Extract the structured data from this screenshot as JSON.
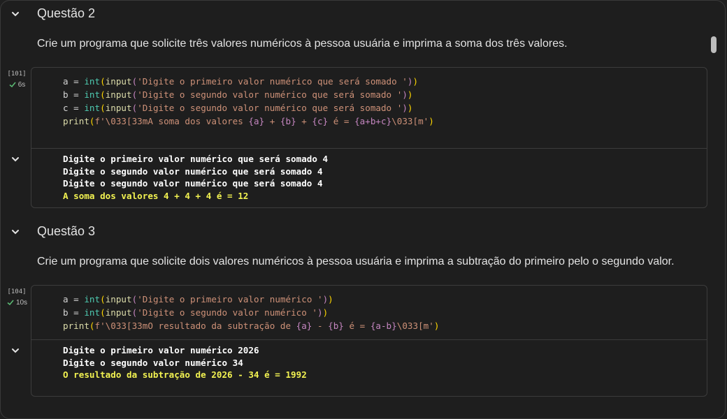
{
  "q2": {
    "title": "Questão 2",
    "desc": "Crie um programa que solicite três valores numéricos à pessoa usuária e imprima a soma dos três valores.",
    "exec_count": "[101]",
    "exec_time": "6s",
    "code": {
      "l1": {
        "pre": "a = ",
        "kw": "int",
        "p1": "(",
        "fn": "input",
        "p2": "(",
        "str": "'Digite o primeiro valor numérico que será somado '",
        "p3": ")",
        "p4": ")"
      },
      "l2": {
        "pre": "b = ",
        "kw": "int",
        "p1": "(",
        "fn": "input",
        "p2": "(",
        "str": "'Digite o segundo valor numérico que será somado '",
        "p3": ")",
        "p4": ")"
      },
      "l3": {
        "pre": "c = ",
        "kw": "int",
        "p1": "(",
        "fn": "input",
        "p2": "(",
        "str": "'Digite o segundo valor numérico que será somado '",
        "p3": ")",
        "p4": ")"
      },
      "l4": {
        "fn": "print",
        "p1": "(",
        "s1": "f'\\033[33mA soma dos valores ",
        "b1": "{a}",
        "s2": " + ",
        "b2": "{b}",
        "s3": " + ",
        "b3": "{c}",
        "s4": " é = ",
        "b4": "{a+b+c}",
        "s5": "\\033[m'",
        "p2": ")"
      }
    },
    "output": [
      "Digite o primeiro valor numérico que será somado 4",
      "Digite o segundo valor numérico que será somado 4",
      "Digite o segundo valor numérico que será somado 4"
    ],
    "output_result": "A soma dos valores 4 + 4 + 4 é = 12"
  },
  "q3": {
    "title": "Questão 3",
    "desc": "Crie um programa que solicite dois valores numéricos à pessoa usuária e imprima a subtração do primeiro pelo o segundo valor.",
    "exec_count": "[104]",
    "exec_time": "10s",
    "code": {
      "l1": {
        "pre": "a = ",
        "kw": "int",
        "p1": "(",
        "fn": "input",
        "p2": "(",
        "str": "'Digite o primeiro valor numérico '",
        "p3": ")",
        "p4": ")"
      },
      "l2": {
        "pre": "b = ",
        "kw": "int",
        "p1": "(",
        "fn": "input",
        "p2": "(",
        "str": "'Digite o segundo valor numérico '",
        "p3": ")",
        "p4": ")"
      },
      "l3": {
        "fn": "print",
        "p1": "(",
        "s1": "f'\\033[33mO resultado da subtração de ",
        "b1": "{a}",
        "s2": " - ",
        "b2": "{b}",
        "s3": " é = ",
        "b3": "{a-b}",
        "s4": "\\033[m'",
        "p2": ")"
      }
    },
    "output": [
      "Digite o primeiro valor numérico 2026",
      "Digite o segundo valor numérico 34"
    ],
    "output_result": "O resultado da subtração de 2026 - 34 é = 1992"
  },
  "colors": {
    "accent_check": "#5bb974",
    "ansi_yellow": "#f2f251"
  },
  "icons": [
    "chevron-down-icon",
    "check-icon"
  ]
}
